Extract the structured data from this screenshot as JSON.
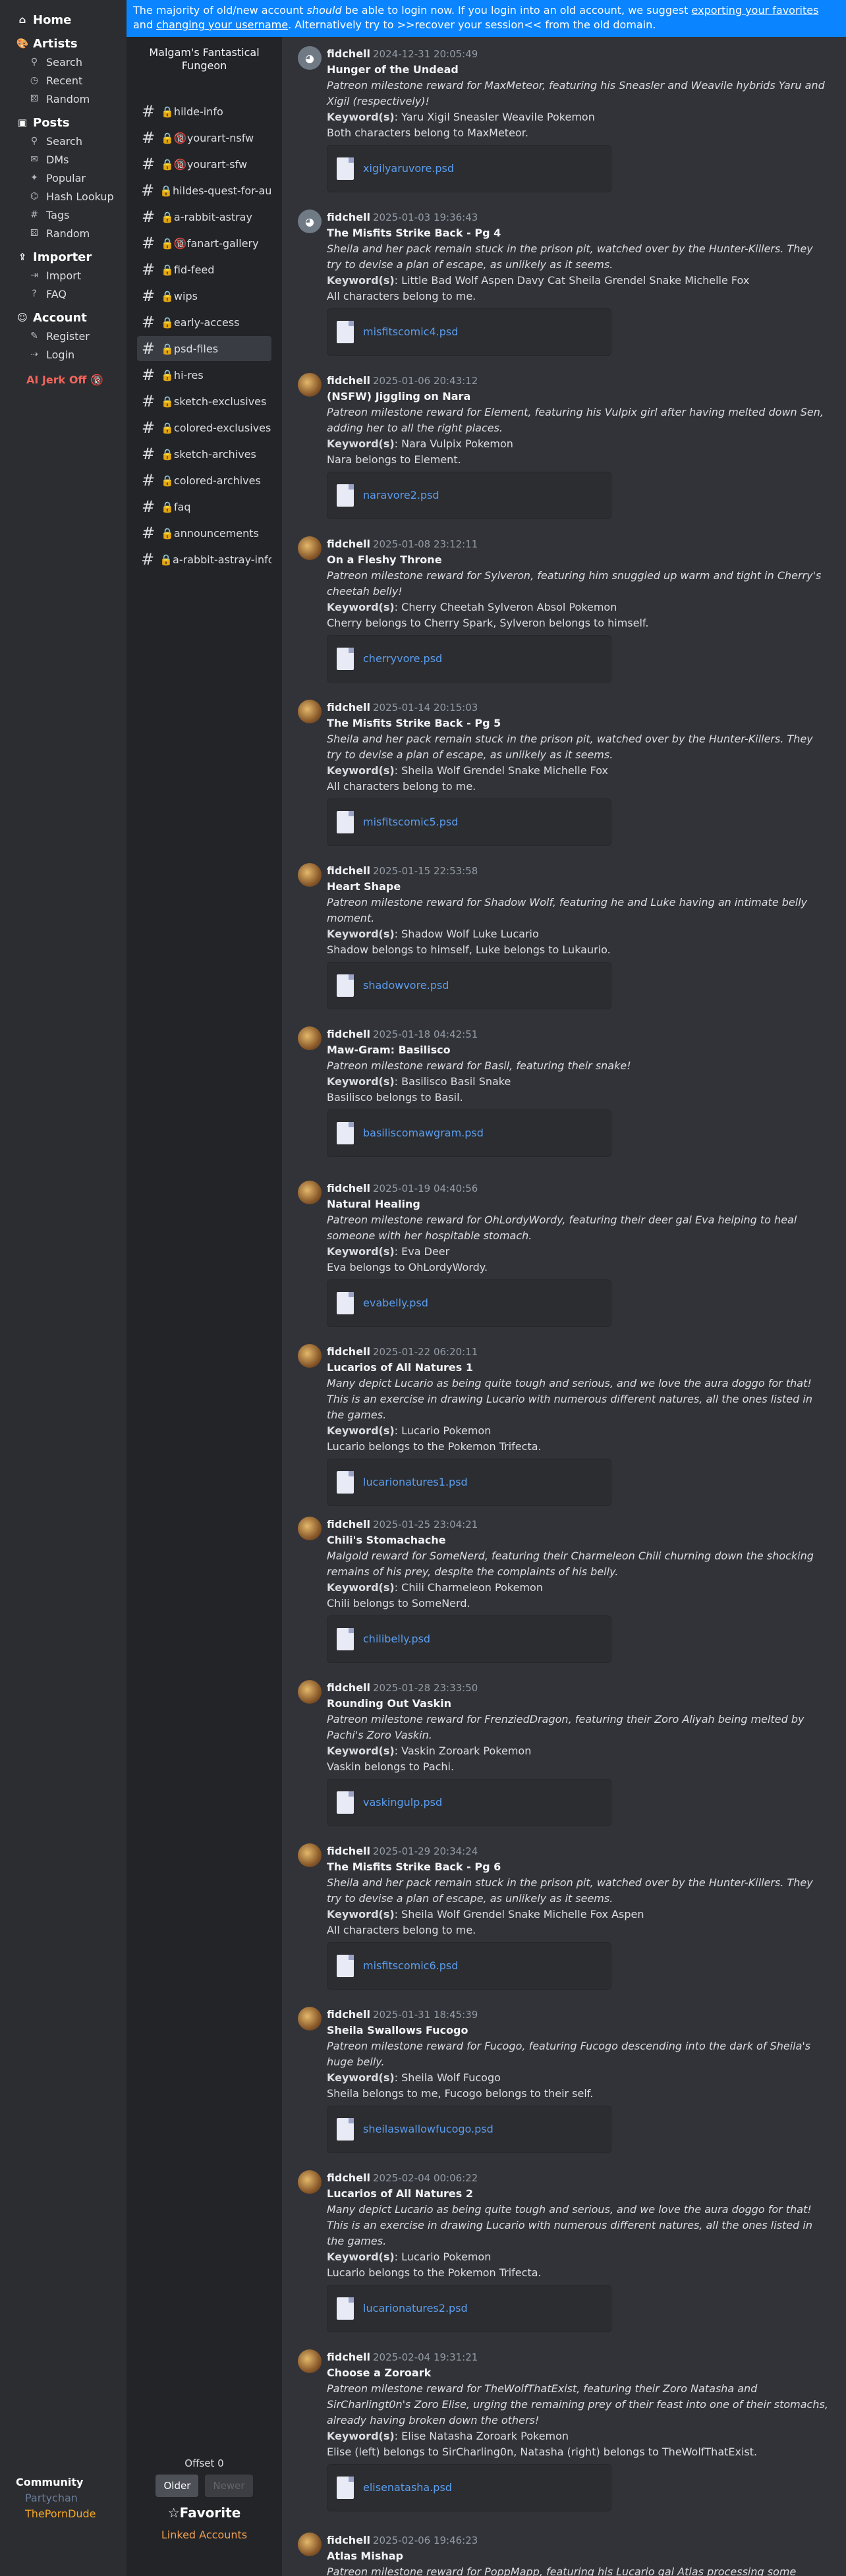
{
  "banner": {
    "t1": "The majority of old/new account ",
    "t2": "should",
    "t3": " be able to login now. If you login into an old account, we suggest ",
    "t4": "exporting your favorites",
    "t5": " and ",
    "t6": "changing your username",
    "t7": ". Alternatively try to ",
    "t8": ">>recover your session<<",
    "t9": " from the old domain."
  },
  "nav": {
    "home": "Home",
    "artists": "Artists",
    "artists_items": [
      "Search",
      "Recent",
      "Random"
    ],
    "posts": "Posts",
    "posts_items": [
      "Search",
      "DMs",
      "Popular",
      "Hash Lookup",
      "Tags",
      "Random"
    ],
    "importer": "Importer",
    "importer_items": [
      "Import",
      "FAQ"
    ],
    "account": "Account",
    "account_items": [
      "Register",
      "Login"
    ],
    "ai": "AI Jerk Off 🔞",
    "community": "Community",
    "community_items": [
      "Partychan",
      "ThePornDude"
    ]
  },
  "server": {
    "name": "Malgam's Fantastical Fungeon",
    "channels": [
      "🔒hilde-info",
      "🔒🔞yourart-nsfw",
      "🔒🔞yourart-sfw",
      "🔒hildes-quest-for-aura",
      "🔒a-rabbit-astray",
      "🔒🔞fanart-gallery",
      "🔒fid-feed",
      "🔒wips",
      "🔒early-access",
      "🔒psd-files",
      "🔒hi-res",
      "🔒sketch-exclusives",
      "🔒colored-exclusives",
      "🔒sketch-archives",
      "🔒colored-archives",
      "🔒faq",
      "🔒announcements",
      "🔒a-rabbit-astray-info"
    ],
    "selected": 9
  },
  "footer": {
    "offset": "Offset 0",
    "older": "Older",
    "newer": "Newer",
    "favorite": "☆Favorite",
    "linked": "Linked Accounts"
  },
  "posts": [
    {
      "user": "fidchell",
      "time": "2024-12-31 20:05:49",
      "title": "Hunger of the Undead",
      "desc": "Patreon milestone reward for MaxMeteor, featuring his Sneasler and Weavile hybrids Yaru and Xigil (respectively)!",
      "kwl": "Keyword(s)",
      "kw": ": Yaru Xigil Sneasler Weavile Pokemon",
      "note": "Both characters belong to MaxMeteor.",
      "file": "xigilyaruvore.psd",
      "av": "discord-icon"
    },
    {
      "user": "fidchell",
      "time": "2025-01-03 19:36:43",
      "title": "The Misfits Strike Back - Pg 4",
      "desc": "Sheila and her pack remain stuck in the prison pit, watched over by the Hunter-Killers. They try to devise a plan of escape, as unlikely as it seems.",
      "kwl": "Keyword(s)",
      "kw": ": Little Bad Wolf Aspen Davy Cat Sheila Grendel Snake Michelle Fox",
      "note": "All characters belong to me.",
      "file": "misfitscomic4.psd",
      "av": "discord-icon"
    },
    {
      "user": "fidchell",
      "time": "2025-01-06 20:43:12",
      "title": "(NSFW) Jiggling on Nara",
      "desc": "Patreon milestone reward for Element, featuring his Vulpix girl after having melted down Sen, adding her to all the right places.",
      "kwl": "Keyword(s)",
      "kw": ": Nara Vulpix Pokemon",
      "note": "Nara belongs to Element.",
      "file": "naravore2.psd",
      "av": "avatar"
    },
    {
      "user": "fidchell",
      "time": "2025-01-08 23:12:11",
      "title": "On a Fleshy Throne",
      "desc": "Patreon milestone reward for Sylveron, featuring him snuggled up warm and tight in Cherry's cheetah belly!",
      "kwl": "Keyword(s)",
      "kw": ": Cherry Cheetah Sylveron Absol Pokemon",
      "note": "Cherry belongs to Cherry Spark, Sylveron belongs to himself.",
      "file": "cherryvore.psd",
      "av": "avatar"
    },
    {
      "user": "fidchell",
      "time": "2025-01-14 20:15:03",
      "title": "The Misfits Strike Back - Pg 5",
      "desc": "Sheila and her pack remain stuck in the prison pit, watched over by the Hunter-Killers. They try to devise a plan of escape, as unlikely as it seems.",
      "kwl": "Keyword(s)",
      "kw": ": Sheila Wolf Grendel Snake Michelle Fox",
      "note": "All characters belong to me.",
      "file": "misfitscomic5.psd",
      "av": "avatar"
    },
    {
      "user": "fidchell",
      "time": "2025-01-15 22:53:58",
      "title": "Heart Shape",
      "desc": "Patreon milestone reward for Shadow Wolf, featuring he and Luke having an intimate belly moment.",
      "kwl": "Keyword(s)",
      "kw": ": Shadow Wolf Luke Lucario",
      "note": "Shadow belongs to himself, Luke belongs to Lukaurio.",
      "file": "shadowvore.psd",
      "av": "avatar"
    },
    {
      "user": "fidchell",
      "time": "2025-01-18 04:42:51",
      "title": "Maw-Gram: Basilisco",
      "desc": "Patreon milestone reward for Basil, featuring their snake!",
      "kwl": "Keyword(s)",
      "kw": ": Basilisco Basil Snake",
      "note": "Basilisco belongs to Basil.",
      "file": "basiliscomawgram.psd",
      "av": "avatar"
    },
    {
      "user": "fidchell",
      "time": "2025-01-19 04:40:56",
      "title": "Natural Healing",
      "desc": "Patreon milestone reward for OhLordyWordy, featuring their deer gal Eva helping to heal someone with her hospitable stomach.",
      "kwl": "Keyword(s)",
      "kw": ": Eva Deer",
      "note": "Eva belongs to OhLordyWordy.",
      "file": "evabelly.psd",
      "av": "avatar"
    },
    {
      "user": "fidchell",
      "time": "2025-01-22 06:20:11",
      "title": "Lucarios of All Natures 1",
      "desc": "Many depict Lucario as being quite tough and serious, and we love the aura doggo for that! This is an exercise in drawing Lucario with numerous different natures, all the ones listed in the games.",
      "kwl": "Keyword(s)",
      "kw": ": Lucario Pokemon",
      "note": "Lucario belongs to the Pokemon Trifecta.",
      "file": "lucarionatures1.psd",
      "av": "avatar"
    },
    {
      "user": "fidchell",
      "time": "2025-01-25 23:04:21",
      "title": "Chili's Stomachache",
      "desc": "Malgold reward for SomeNerd, featuring their Charmeleon Chili churning down the shocking remains of his prey, despite the complaints of his belly.",
      "kwl": "Keyword(s)",
      "kw": ": Chili Charmeleon Pokemon",
      "note": "Chili belongs to SomeNerd.",
      "file": "chilibelly.psd",
      "av": "avatar"
    },
    {
      "user": "fidchell",
      "time": "2025-01-28 23:33:50",
      "title": "Rounding Out Vaskin",
      "desc": "Patreon milestone reward for FrenziedDragon, featuring their Zoro Aliyah being melted by Pachi's Zoro Vaskin.",
      "kwl": "Keyword(s)",
      "kw": ": Vaskin Zoroark Pokemon",
      "note": "Vaskin belongs to Pachi.",
      "file": "vaskingulp.psd",
      "av": "avatar"
    },
    {
      "user": "fidchell",
      "time": "2025-01-29 20:34:24",
      "title": "The Misfits Strike Back - Pg 6",
      "desc": "Sheila and her pack remain stuck in the prison pit, watched over by the Hunter-Killers. They try to devise a plan of escape, as unlikely as it seems.",
      "kwl": "Keyword(s)",
      "kw": ": Sheila Wolf Grendel Snake Michelle Fox Aspen",
      "note": "All characters belong to me.",
      "file": "misfitscomic6.psd",
      "av": "avatar"
    },
    {
      "user": "fidchell",
      "time": "2025-01-31 18:45:39",
      "title": "Sheila Swallows Fucogo",
      "desc": "Patreon milestone reward for Fucogo, featuring Fucogo descending into the dark of Sheila's huge belly.",
      "kwl": "Keyword(s)",
      "kw": ": Sheila Wolf Fucogo",
      "note": "Sheila belongs to me, Fucogo belongs to their self.",
      "file": "sheilaswallowfucogo.psd",
      "av": "avatar"
    },
    {
      "user": "fidchell",
      "time": "2025-02-04 00:06:22",
      "title": "Lucarios of All Natures 2",
      "desc": "Many depict Lucario as being quite tough and serious, and we love the aura doggo for that! This is an exercise in drawing Lucario with numerous different natures, all the ones listed in the games.",
      "kwl": "Keyword(s)",
      "kw": ": Lucario Pokemon",
      "note": "Lucario belongs to the Pokemon Trifecta.",
      "file": "lucarionatures2.psd",
      "av": "avatar"
    },
    {
      "user": "fidchell",
      "time": "2025-02-04 19:31:21",
      "title": "Choose a Zoroark",
      "desc": "Patreon milestone reward for TheWolfThatExist, featuring their Zoro Natasha and SirCharlingt0n's Zoro Elise, urging the remaining prey of their feast into one of their stomachs, already having broken down the others!",
      "kwl": "Keyword(s)",
      "kw": ": Elise Natasha Zoroark Pokemon",
      "note": "Elise (left) belongs to SirCharling0n, Natasha (right) belongs to TheWolfThatExist.",
      "file": "elisenatasha.psd",
      "av": "avatar"
    },
    {
      "user": "fidchell",
      "time": "2025-02-06 19:46:23",
      "title": "Atlas Mishap",
      "desc": "Patreon milestone reward for PoppMapp, featuring his Lucario gal Atlas processing some",
      "kwl": "",
      "kw": "",
      "note": "",
      "file": "",
      "av": "avatar"
    }
  ]
}
